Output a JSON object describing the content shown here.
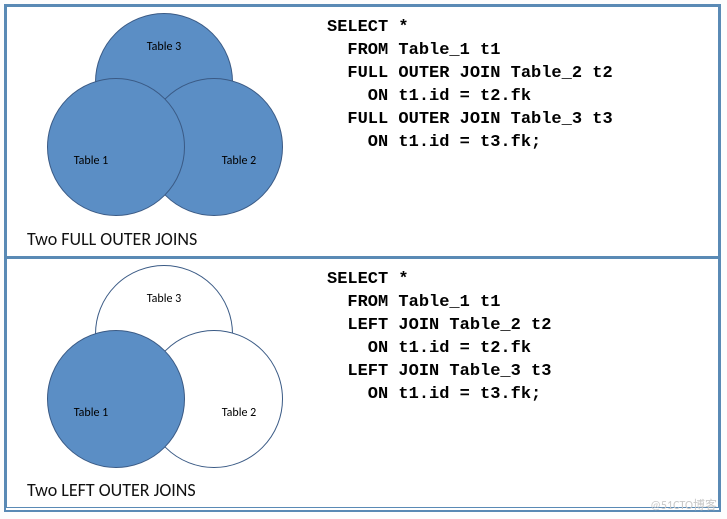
{
  "panel1": {
    "circles": {
      "t1": "Table 1",
      "t2": "Table 2",
      "t3": "Table 3"
    },
    "fill": {
      "t1": true,
      "t2": true,
      "t3": true
    },
    "caption": "Two FULL OUTER JOINS",
    "code": "SELECT *\n  FROM Table_1 t1\n  FULL OUTER JOIN Table_2 t2\n    ON t1.id = t2.fk\n  FULL OUTER JOIN Table_3 t3\n    ON t1.id = t3.fk;"
  },
  "panel2": {
    "circles": {
      "t1": "Table 1",
      "t2": "Table 2",
      "t3": "Table 3"
    },
    "fill": {
      "t1": true,
      "t2": false,
      "t3": false
    },
    "caption": "Two LEFT OUTER JOINS",
    "code": "SELECT *\n  FROM Table_1 t1\n  LEFT JOIN Table_2 t2\n    ON t1.id = t2.fk\n  LEFT JOIN Table_3 t3\n    ON t1.id = t3.fk;"
  },
  "watermark": "@51CTO博客"
}
